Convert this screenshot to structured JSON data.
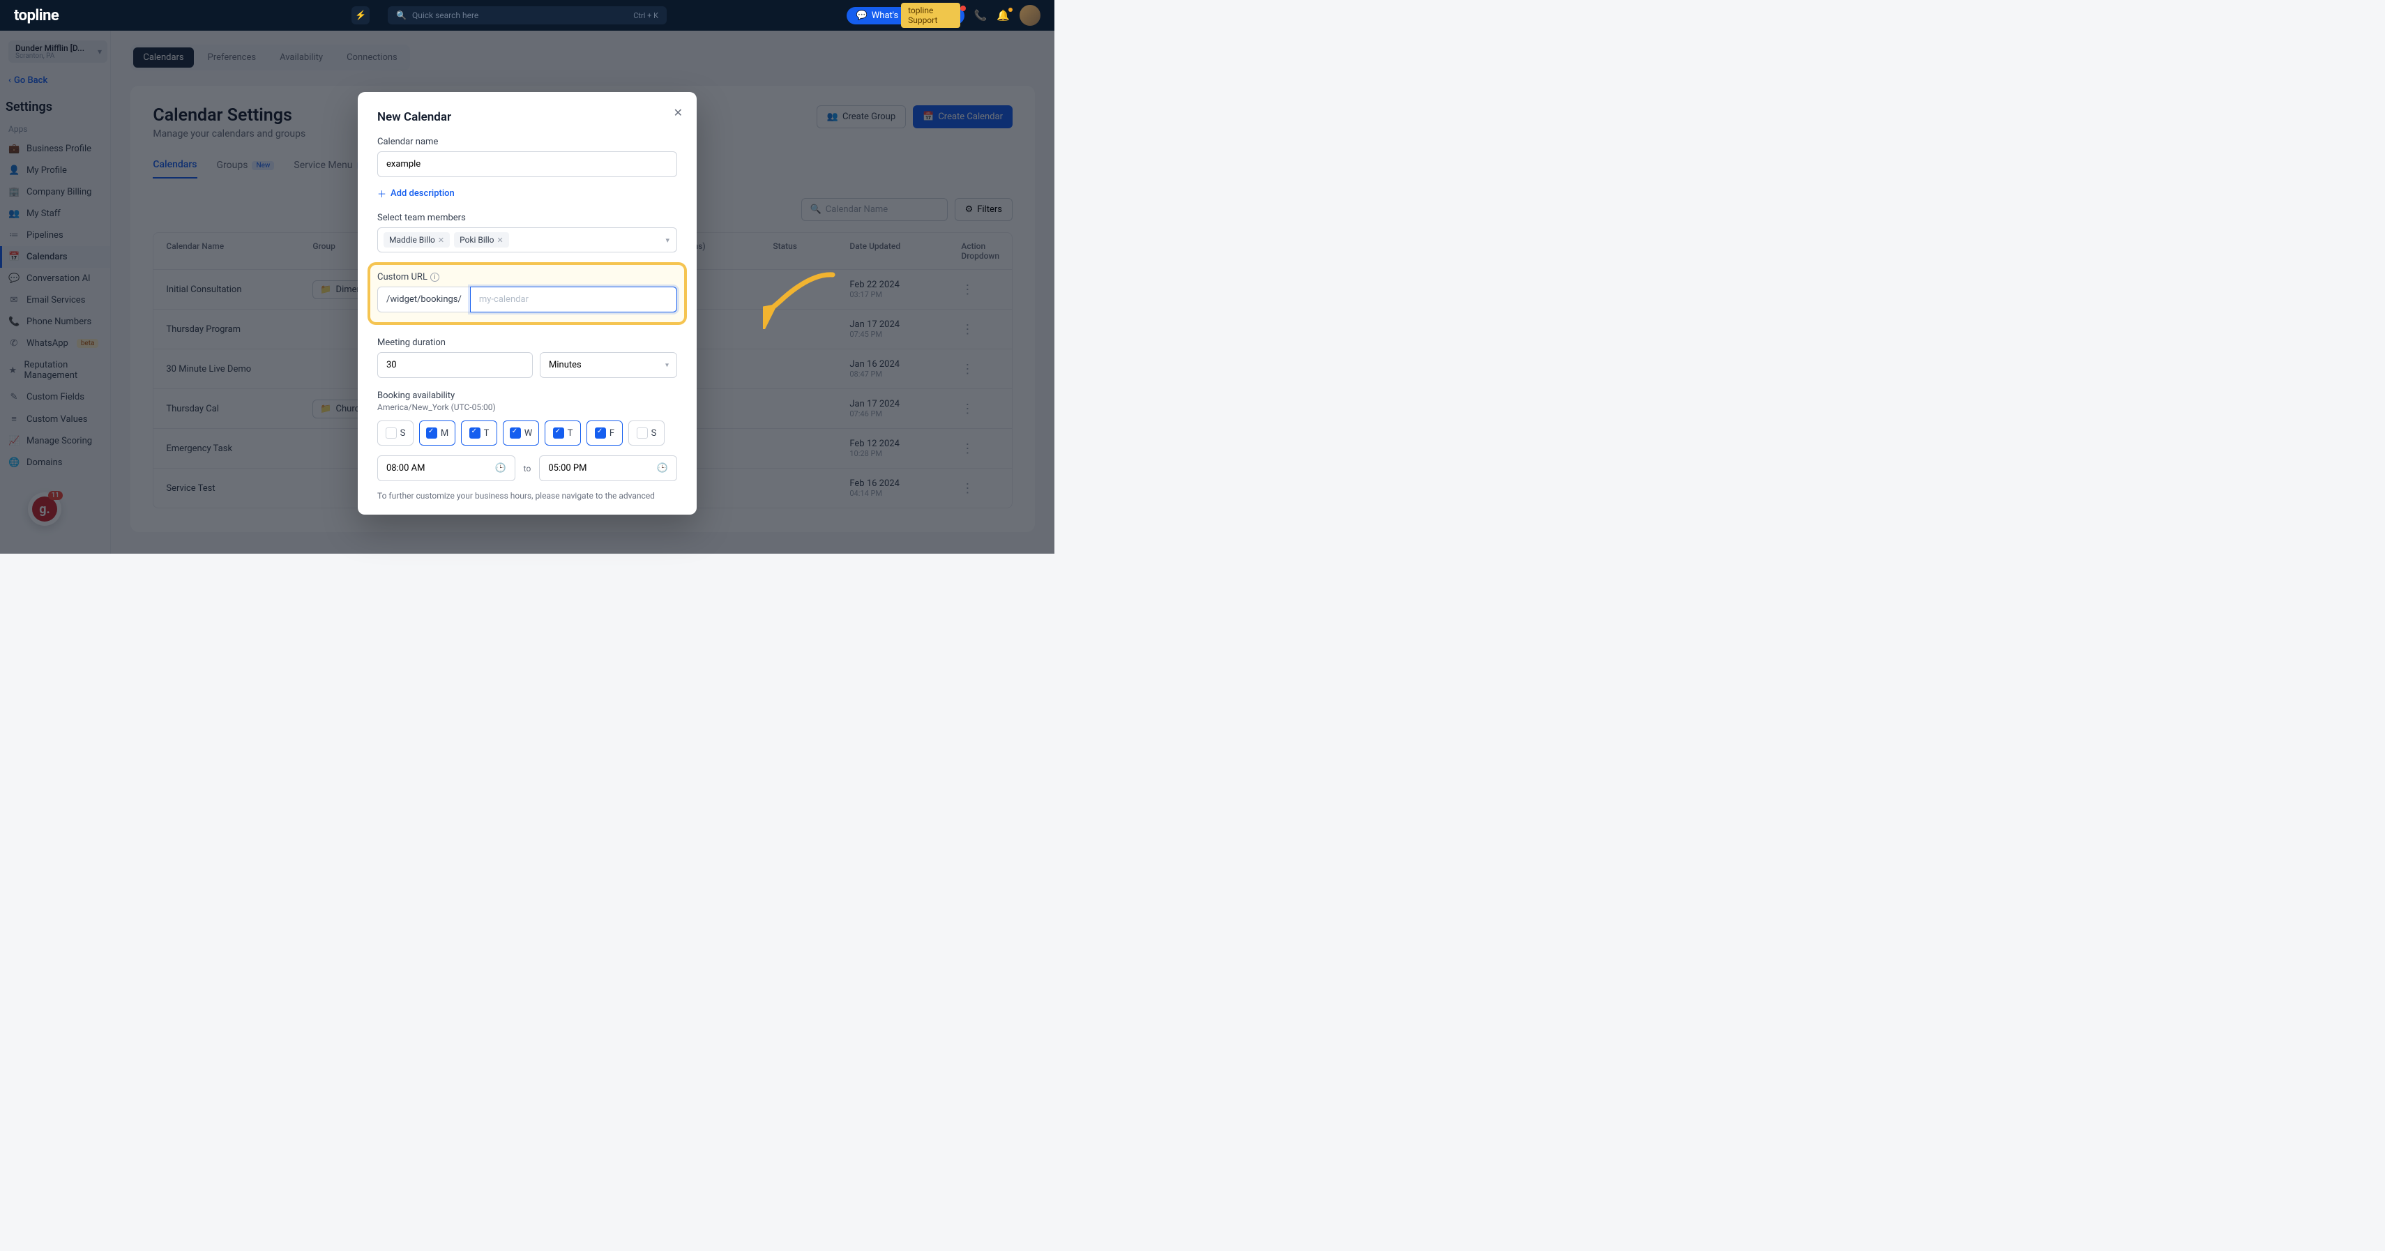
{
  "brand": "topline",
  "search_placeholder": "Quick search here",
  "search_kbd": "Ctrl + K",
  "support_pill": "topline Support",
  "updates_label": "What's New Updates",
  "org": {
    "name": "Dunder Mifflin [D...",
    "location": "Scranton, PA"
  },
  "go_back": "Go Back",
  "settings_title": "Settings",
  "side_group": "Apps",
  "sidebar": [
    {
      "icon": "💼",
      "label": "Business Profile"
    },
    {
      "icon": "👤",
      "label": "My Profile"
    },
    {
      "icon": "🏢",
      "label": "Company Billing"
    },
    {
      "icon": "👥",
      "label": "My Staff"
    },
    {
      "icon": "≔",
      "label": "Pipelines"
    },
    {
      "icon": "📅",
      "label": "Calendars"
    },
    {
      "icon": "💬",
      "label": "Conversation AI"
    },
    {
      "icon": "✉",
      "label": "Email Services"
    },
    {
      "icon": "📞",
      "label": "Phone Numbers"
    },
    {
      "icon": "✆",
      "label": "WhatsApp",
      "beta": "beta"
    },
    {
      "icon": "★",
      "label": "Reputation Management"
    },
    {
      "icon": "✎",
      "label": "Custom Fields"
    },
    {
      "icon": "≡",
      "label": "Custom Values"
    },
    {
      "icon": "📈",
      "label": "Manage Scoring"
    },
    {
      "icon": "🌐",
      "label": "Domains"
    }
  ],
  "guru_badge": "11",
  "nav_pills": [
    "Calendars",
    "Preferences",
    "Availability",
    "Connections"
  ],
  "page": {
    "title": "Calendar Settings",
    "sub": "Manage your calendars and groups"
  },
  "actions": {
    "create_group": "Create Group",
    "create_cal": "Create Calendar"
  },
  "tabs": {
    "calendars": "Calendars",
    "groups": "Groups",
    "service_menu": "Service Menu",
    "new_pill": "New"
  },
  "cal_search_placeholder": "Calendar Name",
  "filters_label": "Filters",
  "columns": {
    "name": "Calendar Name",
    "group": "Group",
    "dur": "Duration (mins)",
    "status": "Status",
    "date": "Date Updated",
    "action": "Action Dropdown"
  },
  "rows": [
    {
      "name": "Initial Consultation",
      "group": "Dimension Adm...",
      "date": "Feb 22 2024",
      "time": "03:17 PM"
    },
    {
      "name": "Thursday Program",
      "group": "",
      "date": "Jan 17 2024",
      "time": "07:45 PM"
    },
    {
      "name": "30 Minute Live Demo",
      "group": "",
      "date": "Jan 16 2024",
      "time": "08:47 PM"
    },
    {
      "name": "Thursday Cal",
      "group": "Church Program...",
      "date": "Jan 17 2024",
      "time": "07:46 PM"
    },
    {
      "name": "Emergency Task",
      "group": "",
      "date": "Feb 12 2024",
      "time": "10:28 PM"
    },
    {
      "name": "Service Test",
      "group": "",
      "date": "Feb 16 2024",
      "time": "04:14 PM"
    }
  ],
  "modal": {
    "title": "New Calendar",
    "name_label": "Calendar name",
    "name_value": "example",
    "add_desc": "Add description",
    "select_team": "Select team members",
    "tags": [
      "Maddie Billo",
      "Poki Billo"
    ],
    "custom_url_label": "Custom URL",
    "url_prefix": "/widget/bookings/",
    "url_placeholder": "my-calendar",
    "meeting_dur_label": "Meeting duration",
    "dur_value": "30",
    "dur_unit": "Minutes",
    "booking_label": "Booking availability",
    "tz": "America/New_York (UTC-05:00)",
    "days": [
      {
        "l": "S",
        "on": false
      },
      {
        "l": "M",
        "on": true
      },
      {
        "l": "T",
        "on": true
      },
      {
        "l": "W",
        "on": true
      },
      {
        "l": "T",
        "on": true
      },
      {
        "l": "F",
        "on": true
      },
      {
        "l": "S",
        "on": false
      }
    ],
    "t_from": "08:00 AM",
    "t_to_label": "to",
    "t_to": "05:00 PM",
    "footer": "To further customize your business hours, please navigate to the advanced"
  }
}
